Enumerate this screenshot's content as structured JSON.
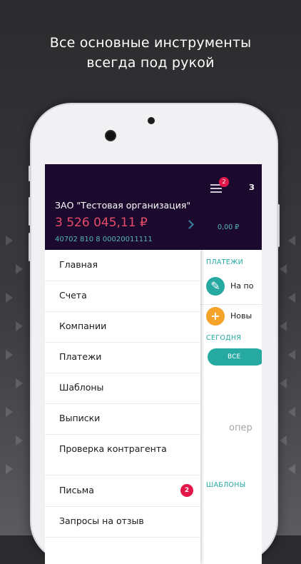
{
  "promo": {
    "line1": "Все основные инструменты",
    "line2": "всегда под рукой"
  },
  "header": {
    "organization": "ЗАО \"Тестовая организация\"",
    "balance": "3 526 045,11 ₽",
    "account": "40702 810 8 00020011111",
    "menu_badge": "2",
    "right_title": "З",
    "right_amount": "0,00 ₽"
  },
  "menu": {
    "items": [
      {
        "label": "Главная"
      },
      {
        "label": "Счета"
      },
      {
        "label": "Компании"
      },
      {
        "label": "Платежи"
      },
      {
        "label": "Шаблоны"
      },
      {
        "label": "Выписки"
      },
      {
        "label": "Проверка контрагента"
      },
      {
        "label": "Письма",
        "badge": "2"
      },
      {
        "label": "Запросы на отзыв"
      }
    ]
  },
  "right_panel": {
    "payments_label": "ПЛАТЕЖИ",
    "payment1": "На по",
    "payment2": "Новы",
    "today_label": "СЕГОДНЯ",
    "filter_all": "ВСЕ",
    "empty_text": "опер",
    "templates_label": "ШАБЛОНЫ"
  },
  "colors": {
    "accent": "#26a9a1",
    "header_bg": "#1b0a2d",
    "balance": "#e84a6a",
    "badge": "#e3164a",
    "orange": "#f5a32b"
  }
}
